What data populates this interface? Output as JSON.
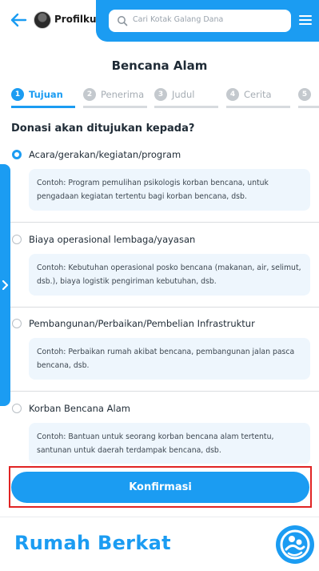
{
  "header": {
    "profile_label": "Profilku",
    "search_placeholder": "Cari Kotak Galang Dana"
  },
  "page_title": "Bencana Alam",
  "steps": [
    {
      "num": "1",
      "label": "Tujuan",
      "active": true
    },
    {
      "num": "2",
      "label": "Penerima",
      "active": false
    },
    {
      "num": "3",
      "label": "Judul",
      "active": false
    },
    {
      "num": "4",
      "label": "Cerita",
      "active": false
    },
    {
      "num": "5",
      "label": "",
      "active": false
    }
  ],
  "question": "Donasi akan ditujukan kepada?",
  "options": [
    {
      "label": "Acara/gerakan/kegiatan/program",
      "checked": true,
      "example": "Contoh: Program pemulihan psikologis korban bencana, untuk pengadaan kegiatan tertentu bagi korban bencana, dsb."
    },
    {
      "label": "Biaya operasional lembaga/yayasan",
      "checked": false,
      "example": "Contoh: Kebutuhan operasional posko bencana (makanan, air, selimut, dsb.), biaya logistik pengiriman kebutuhan, dsb."
    },
    {
      "label": "Pembangunan/Perbaikan/Pembelian Infrastruktur",
      "checked": false,
      "example": "Contoh: Perbaikan rumah akibat bencana, pembangunan jalan pasca bencana, dsb."
    },
    {
      "label": "Korban Bencana Alam",
      "checked": false,
      "example": "Contoh: Bantuan untuk seorang korban bencana alam tertentu, santunan untuk daerah terdampak bencana, dsb."
    }
  ],
  "confirm_label": "Konfirmasi",
  "brand": "Rumah Berkat",
  "colors": {
    "accent": "#1b9cf2",
    "highlight": "#e02424"
  }
}
